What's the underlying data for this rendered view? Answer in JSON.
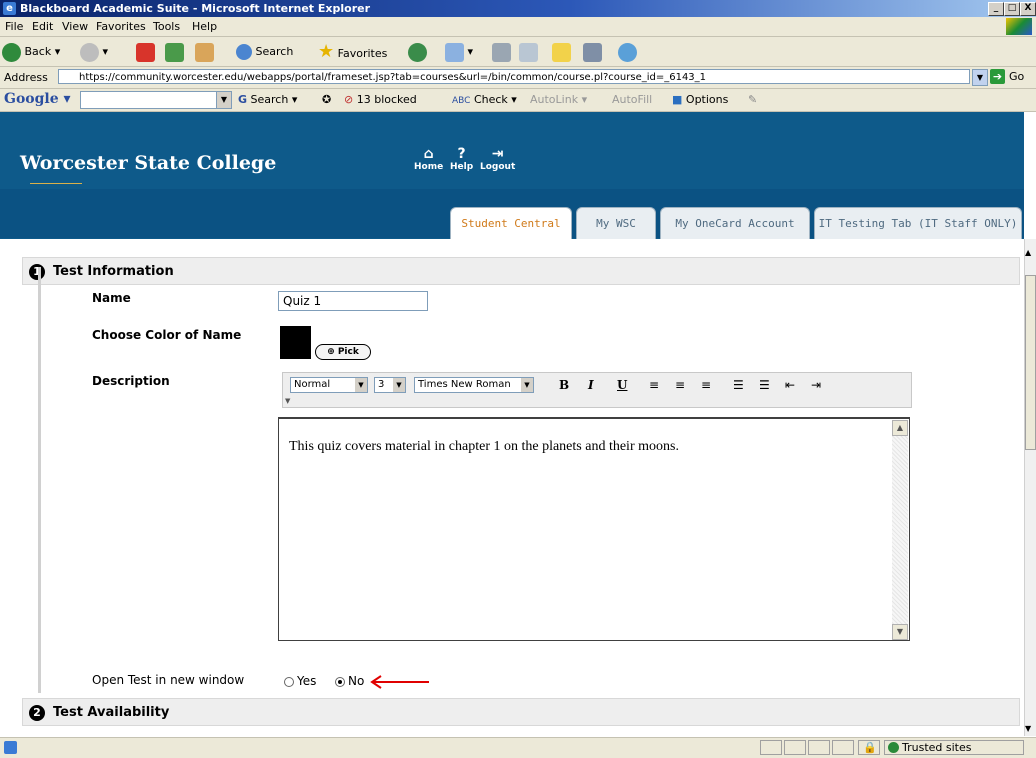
{
  "window": {
    "title": "Blackboard Academic Suite - Microsoft Internet Explorer",
    "controls": {
      "minimize": "_",
      "maximize": "□",
      "close": "X"
    }
  },
  "menu": [
    "File",
    "Edit",
    "View",
    "Favorites",
    "Tools",
    "Help"
  ],
  "toolbar": {
    "back": "Back",
    "search": "Search",
    "favorites": "Favorites"
  },
  "address": {
    "label": "Address",
    "url": "https://community.worcester.edu/webapps/portal/frameset.jsp?tab=courses&url=/bin/common/course.pl?course_id=_6143_1",
    "go": "Go"
  },
  "googlebar": {
    "logo": "Google",
    "search": "Search",
    "blocked": "13 blocked",
    "check": "Check",
    "autolink": "AutoLink",
    "autofill": "AutoFill",
    "options": "Options"
  },
  "header": {
    "college": "Worcester State College",
    "nav": [
      "Home",
      "Help",
      "Logout"
    ],
    "tabs": [
      "Student Central",
      "My WSC",
      "My OneCard Account",
      "IT Testing Tab (IT Staff ONLY)"
    ],
    "active_tab": "Student Central"
  },
  "form": {
    "section1": {
      "number": "1",
      "title": "Test Information"
    },
    "name_label": "Name",
    "name_value": "Quiz 1",
    "color_label": "Choose Color of Name",
    "color_value": "#000000",
    "pick_label": "Pick",
    "description_label": "Description",
    "editor": {
      "style": "Normal",
      "size": "3",
      "font": "Times New Roman",
      "bold": "B",
      "italic": "I",
      "underline": "U"
    },
    "description_text": "This quiz covers material in chapter 1 on the planets and their moons.",
    "open_new_window_label": "Open Test in new window",
    "yes_label": "Yes",
    "no_label": "No",
    "open_new_window_selected": "No",
    "section2": {
      "number": "2",
      "title": "Test Availability"
    }
  },
  "status": {
    "zone": "Trusted sites"
  },
  "colors": {
    "header_blue": "#0e5a8a",
    "active_tab_text": "#d07a1a",
    "arrow_red": "#e00000"
  }
}
